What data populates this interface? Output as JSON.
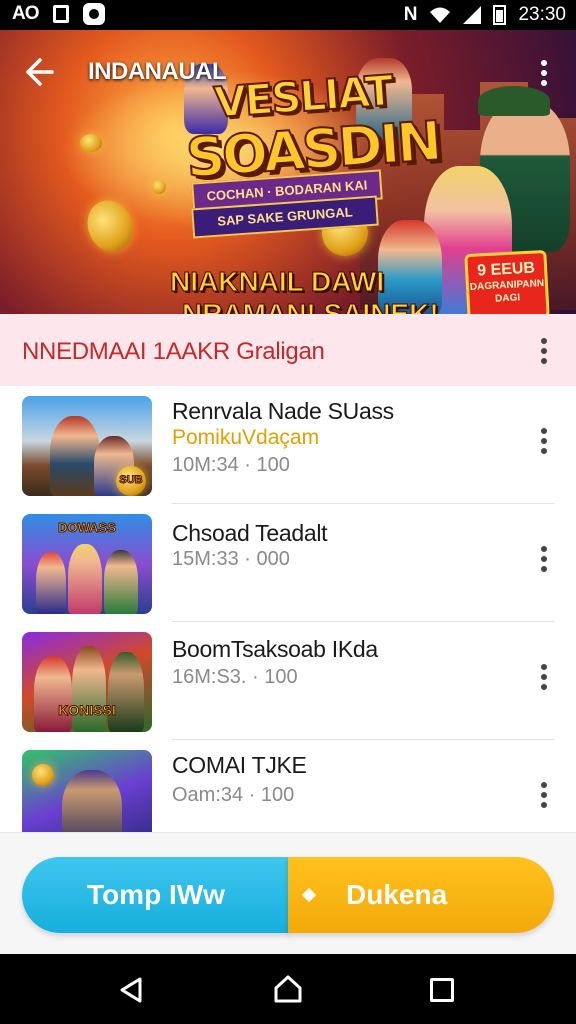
{
  "status_bar": {
    "left_text": "AO",
    "time": "23:30"
  },
  "banner": {
    "title": "INDANAUAL",
    "logo_line1": "VESLIAT",
    "logo_line2": "SOASDIN",
    "ribbon_line1": "COCHAN · BODARAN KAI",
    "ribbon_line2": "SAP SAKE GRUNGAL",
    "tagline_line1": "NIAKNAIL DAWI",
    "tagline_line2": "NRAMAN! SAINEK!",
    "badge_line1": "9 EEUB",
    "badge_line2": "DAGRANIPANN",
    "badge_line3": "DAGI"
  },
  "section": {
    "title": "NNEDMAAI 1AAKR Graligan"
  },
  "list": [
    {
      "title": "Renrvala Nade SUass",
      "subtitle": "PomikuVdaçam",
      "meta": "10M:34 · 100"
    },
    {
      "title": "Chsoad Teadalt",
      "subtitle": "",
      "meta": "15M:33 · 000"
    },
    {
      "title": "BoomTsaksoab IKda",
      "subtitle": "",
      "meta": "16M:S3. · 100"
    },
    {
      "title": "COMAI TJKE",
      "subtitle": "",
      "meta": "Oam:34 · 100"
    }
  ],
  "thumb_labels": {
    "t2": "DOWASS",
    "t3": "KONISSI",
    "t1": "SUB"
  },
  "buttons": {
    "left_label": "Tomp IWw",
    "right_label": "Dukena"
  },
  "colors": {
    "section_title": "#c62828",
    "subtitle_accent": "#e0a100",
    "button_left": "#17aedd",
    "button_right": "#f3a90a"
  },
  "icons": {
    "back": "arrow-left-icon",
    "more": "more-vertical-icon",
    "nav_back": "triangle-back-icon",
    "nav_home": "home-icon",
    "nav_recent": "square-recent-icon"
  }
}
